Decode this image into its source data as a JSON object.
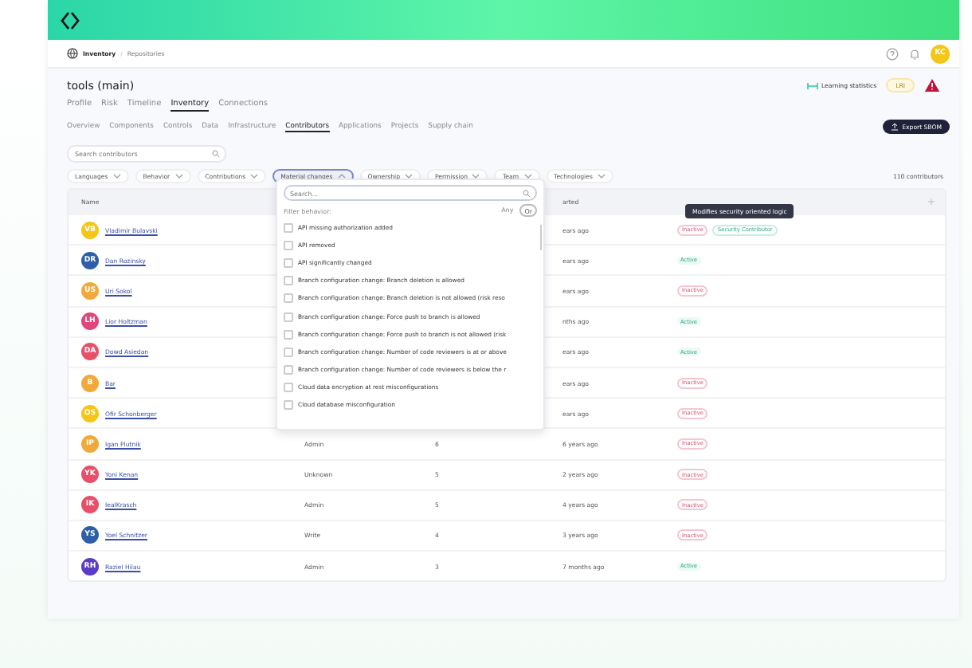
{
  "breadcrumb": [
    "Inventory",
    "Repositories"
  ],
  "breadcrumb_separator": "/",
  "user": {
    "initials": "KC"
  },
  "title": "tools (main)",
  "learning": "Learning statistics",
  "badge": "LRI",
  "tabs": [
    {
      "label": "Profile",
      "selected": false
    },
    {
      "label": "Risk",
      "selected": false
    },
    {
      "label": "Timeline",
      "selected": false
    },
    {
      "label": "Inventory",
      "selected": true
    },
    {
      "label": "Connections",
      "selected": false
    }
  ],
  "subtabs": [
    {
      "label": "Overview",
      "selected": false
    },
    {
      "label": "Components",
      "selected": false
    },
    {
      "label": "Controls",
      "selected": false
    },
    {
      "label": "Data",
      "selected": false
    },
    {
      "label": "Infrastructure",
      "selected": false
    },
    {
      "label": "Contributors",
      "selected": true
    },
    {
      "label": "Applications",
      "selected": false
    },
    {
      "label": "Projects",
      "selected": false
    },
    {
      "label": "Supply chain",
      "selected": false
    }
  ],
  "export_button": "Export SBOM",
  "search": {
    "placeholder": "Search contributors"
  },
  "filters": [
    {
      "label": "Languages",
      "open": false
    },
    {
      "label": "Behavior",
      "open": false
    },
    {
      "label": "Contributions",
      "open": false
    },
    {
      "label": "Material changes",
      "open": true
    },
    {
      "label": "Ownership",
      "open": false
    },
    {
      "label": "Permission",
      "open": false
    },
    {
      "label": "Team",
      "open": false
    },
    {
      "label": "Technologies",
      "open": false
    }
  ],
  "count": "110 contributors",
  "table": {
    "columns": [
      "Name",
      "arted"
    ],
    "rows": [
      {
        "initials": "VB",
        "color": "#f5c518",
        "name": "Vladimir Bulavski",
        "started": "ears ago",
        "tags": [
          {
            "label": "Inactive",
            "kind": "inactive"
          },
          {
            "label": "Security Contributor",
            "kind": "security"
          }
        ]
      },
      {
        "initials": "DR",
        "color": "#2d5fa8",
        "name": "Dan Rozinsky",
        "started": "ears ago",
        "tags": [
          {
            "label": "Active",
            "kind": "active"
          }
        ]
      },
      {
        "initials": "US",
        "color": "#f0a93a",
        "name": "Uri Sokol",
        "started": "ears ago",
        "tags": [
          {
            "label": "Inactive",
            "kind": "inactive"
          }
        ]
      },
      {
        "initials": "LH",
        "color": "#e0457b",
        "name": "Lior Holtzman",
        "started": "nths ago",
        "tags": [
          {
            "label": "Active",
            "kind": "active"
          }
        ]
      },
      {
        "initials": "DA",
        "color": "#e8506a",
        "name": "Dowd Asiedan",
        "started": "ears ago",
        "tags": [
          {
            "label": "Active",
            "kind": "active"
          }
        ]
      },
      {
        "initials": "B",
        "color": "#f0a93a",
        "name": "Bar",
        "started": "ears ago",
        "tags": [
          {
            "label": "Inactive",
            "kind": "inactive"
          }
        ]
      },
      {
        "initials": "OS",
        "color": "#f5c518",
        "name": "Ofir Schonberger",
        "started": "ears ago",
        "tags": [
          {
            "label": "Inactive",
            "kind": "inactive"
          }
        ]
      },
      {
        "initials": "IP",
        "color": "#f0a93a",
        "name": "Igan Plutnik",
        "permission": "Admin",
        "column_3": "6",
        "started": "6 years ago",
        "tags": [
          {
            "label": "Inactive",
            "kind": "inactive"
          }
        ]
      },
      {
        "initials": "YK",
        "color": "#e8506a",
        "name": "Yoni Kenan",
        "permission": "Unknown",
        "column_3": "5",
        "started": "2 years ago",
        "tags": [
          {
            "label": "Inactive",
            "kind": "inactive"
          }
        ]
      },
      {
        "initials": "IK",
        "color": "#e8506a",
        "name": "IealKrasch",
        "permission": "Admin",
        "column_3": "5",
        "started": "4 years ago",
        "tags": [
          {
            "label": "Inactive",
            "kind": "inactive"
          }
        ]
      },
      {
        "initials": "YS",
        "color": "#2d5fa8",
        "name": "Yoel Schnitzer",
        "permission": "Write",
        "column_3": "4",
        "started": "3 years ago",
        "tags": [
          {
            "label": "Inactive",
            "kind": "inactive"
          }
        ]
      },
      {
        "initials": "RH",
        "color": "#5b3cc4",
        "name": "Raziel Hilau",
        "permission": "Admin",
        "column_3": "3",
        "started": "7 months ago",
        "tags": [
          {
            "label": "Active",
            "kind": "active"
          }
        ]
      }
    ]
  },
  "tooltip": "Modifies security oriented logic",
  "dropdown": {
    "search_placeholder": "Search...",
    "filter_label": "Filter behavior:",
    "mode_options": [
      {
        "label": "Any",
        "selected": false
      },
      {
        "label": "Or",
        "selected": true
      }
    ],
    "options": [
      {
        "label": "API missing authorization added",
        "checked": false
      },
      {
        "label": "API removed",
        "checked": false
      },
      {
        "label": "API significantly changed",
        "checked": false
      },
      {
        "label": "Branch configuration change: Branch deletion is allowed",
        "checked": false
      },
      {
        "label": "Branch configuration change: Branch deletion is not allowed (risk reso",
        "checked": false
      },
      {
        "label": "Branch configuration change: Force push to branch is allowed",
        "checked": false
      },
      {
        "label": "Branch configuration change: Force push to branch is not allowed (risk",
        "checked": false
      },
      {
        "label": "Branch configuration change: Number of code reviewers is at or above",
        "checked": false
      },
      {
        "label": "Branch configuration change: Number of code reviewers is below the r",
        "checked": false
      },
      {
        "label": "Cloud data encryption at rest misconfigurations",
        "checked": false
      },
      {
        "label": "Cloud database misconfiguration",
        "checked": false
      }
    ]
  }
}
